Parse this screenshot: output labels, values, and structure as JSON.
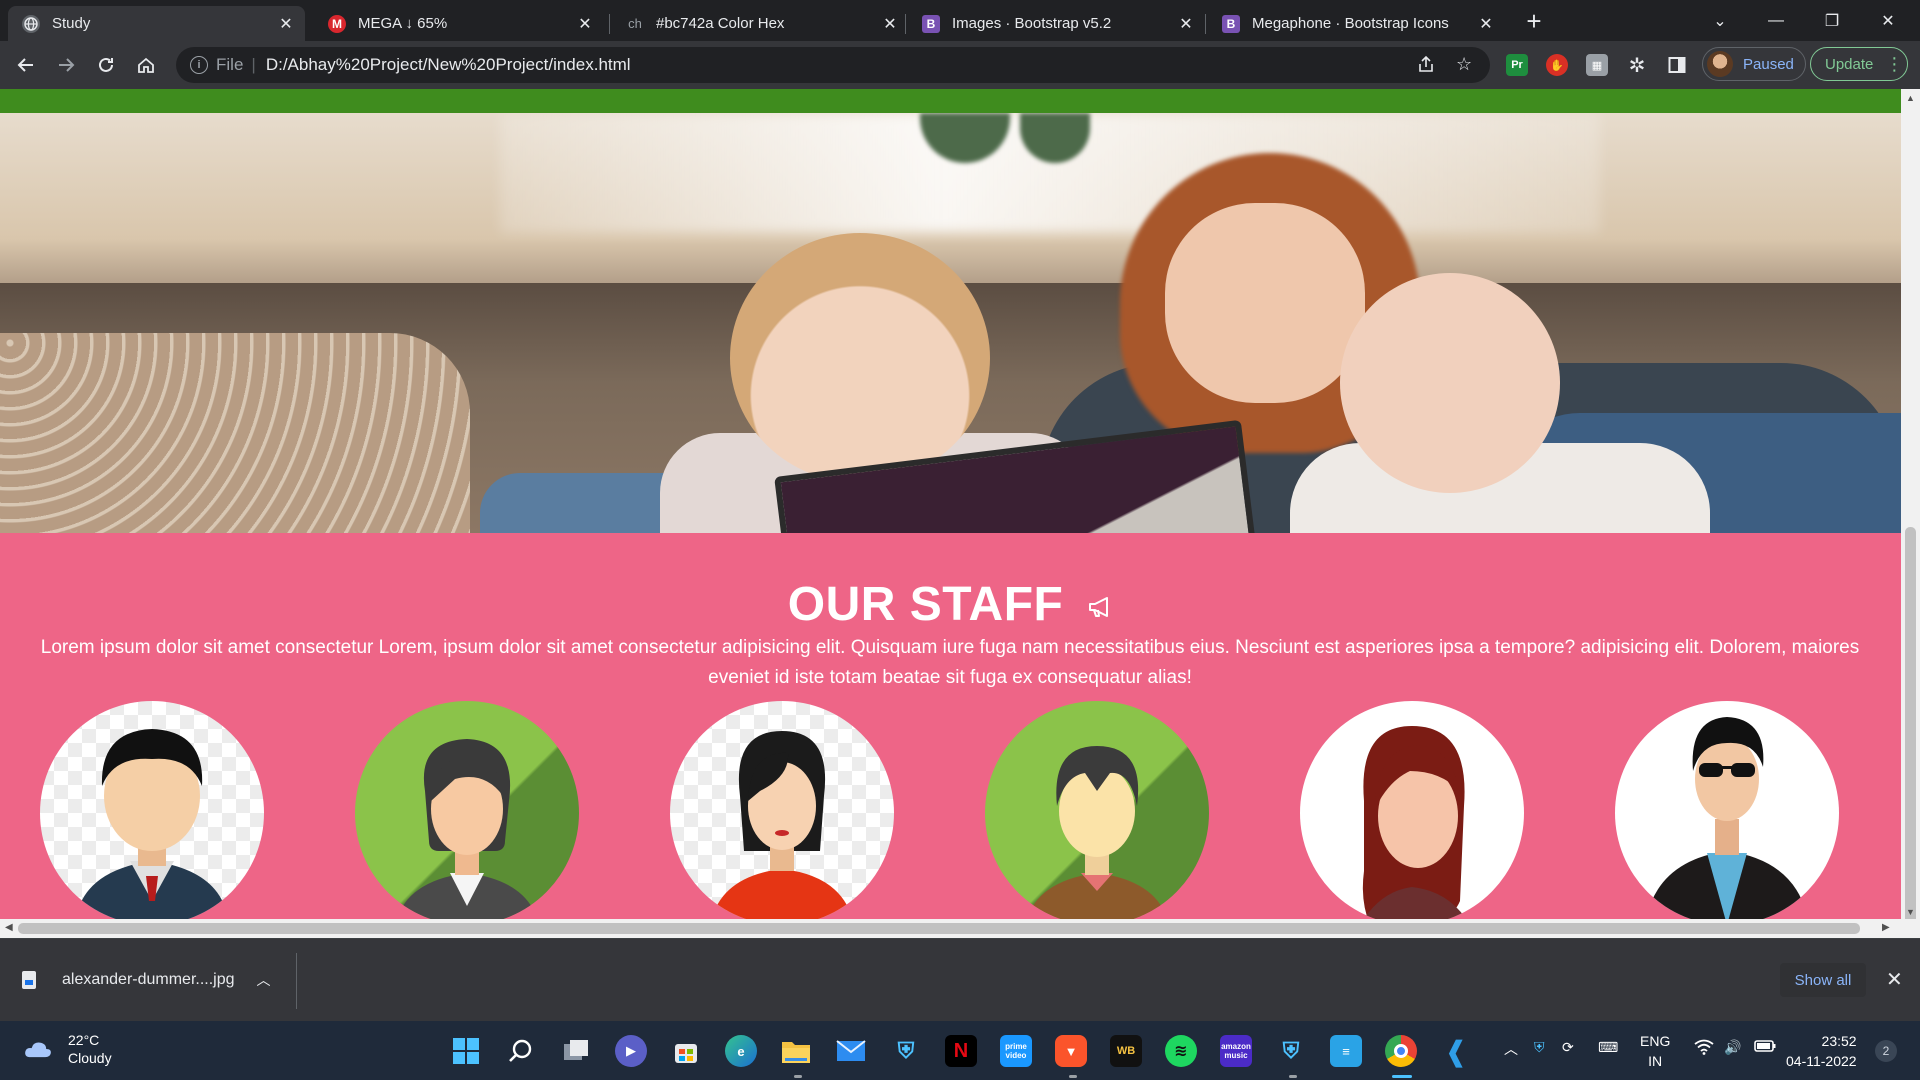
{
  "browser": {
    "tabs": [
      {
        "title": "Study",
        "favicon": "globe-icon",
        "favicon_color": "#5f6368"
      },
      {
        "title": "MEGA ↓ 65%",
        "favicon": "mega-icon",
        "favicon_color": "#d9272e"
      },
      {
        "title": "#bc742a Color Hex",
        "favicon": "colorhex-icon",
        "favicon_color": "#202124"
      },
      {
        "title": "Images · Bootstrap v5.2",
        "favicon": "bootstrap-icon",
        "favicon_color": "#7952b3"
      },
      {
        "title": "Megaphone · Bootstrap Icons",
        "favicon": "bootstrap-icon",
        "favicon_color": "#7952b3"
      }
    ],
    "address": {
      "scheme": "File",
      "url": "D:/Abhay%20Project/New%20Project/index.html"
    },
    "profile_label": "Paused",
    "update_label": "Update"
  },
  "page": {
    "staff_title": "OUR STAFF",
    "staff_description": "Lorem ipsum dolor sit amet consectetur Lorem, ipsum dolor sit amet consectetur adipisicing elit. Quisquam iure fuga nam necessitatibus eius. Nesciunt est asperiores ipsa a tempore? adipisicing elit. Dolorem, maiores eveniet id iste totam beatae sit fuga ex consequatur alias!",
    "colors": {
      "green_band": "#3f8c1e",
      "staff_bg": "#ee6587"
    }
  },
  "downloads": {
    "file_name": "alexander-dummer....jpg",
    "show_all_label": "Show all"
  },
  "taskbar": {
    "weather_temp": "22°C",
    "weather_desc": "Cloudy",
    "lang_primary": "ENG",
    "lang_secondary": "IN",
    "time": "23:52",
    "date": "04-11-2022",
    "notification_count": "2",
    "apps": [
      "windows-start-icon",
      "search-icon",
      "task-view-icon",
      "chat-icon",
      "store-icon",
      "edge-icon",
      "file-explorer-icon",
      "mail-icon",
      "defender-icon",
      "netflix-icon",
      "prime-video-icon",
      "brave-icon",
      "wb-icon",
      "spotify-icon",
      "amazon-music-icon",
      "security-icon",
      "notepad-icon",
      "chrome-icon",
      "vscode-icon"
    ]
  }
}
